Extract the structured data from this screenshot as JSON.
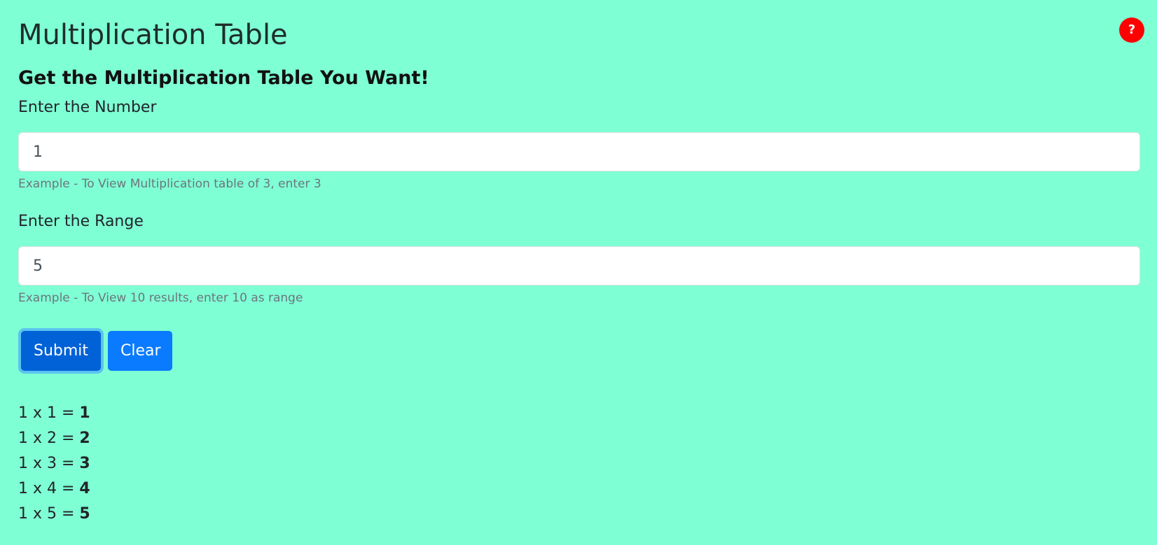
{
  "help": {
    "label": "?"
  },
  "header": {
    "title": "Multiplication Table",
    "subtitle": "Get the Multiplication Table You Want!"
  },
  "form": {
    "number": {
      "label": "Enter the Number",
      "value": "1",
      "help": "Example - To View Multiplication table of 3, enter 3"
    },
    "range": {
      "label": "Enter the Range",
      "value": "5",
      "help": "Example - To View 10 results, enter 10 as range"
    },
    "submit_label": "Submit",
    "clear_label": "Clear"
  },
  "results": [
    {
      "expr": "1 x 1 = ",
      "answer": "1"
    },
    {
      "expr": "1 x 2 = ",
      "answer": "2"
    },
    {
      "expr": "1 x 3 = ",
      "answer": "3"
    },
    {
      "expr": "1 x 4 = ",
      "answer": "4"
    },
    {
      "expr": "1 x 5 = ",
      "answer": "5"
    }
  ],
  "colors": {
    "background": "#7fffd4",
    "help_button": "#ff0000",
    "submit_button": "#0062d6",
    "clear_button": "#0a7bff"
  }
}
